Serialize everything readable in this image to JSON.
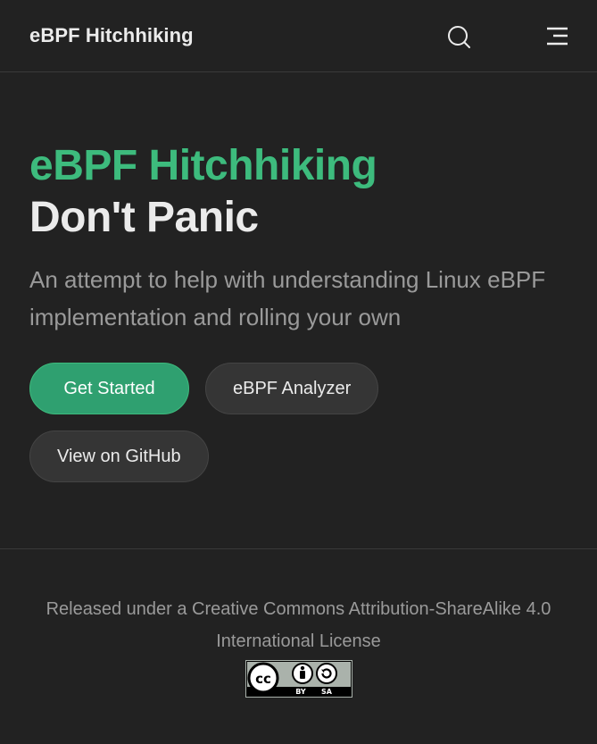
{
  "navbar": {
    "site_title": "eBPF Hitchhiking",
    "icons": {
      "search": "search-icon",
      "menu": "menu-icon"
    }
  },
  "hero": {
    "name": "eBPF Hitchhiking",
    "text": "Don't Panic",
    "tagline": "An attempt to help with understanding Linux eBPF implementation and rolling your own"
  },
  "actions": [
    {
      "label": "Get Started",
      "theme": "brand"
    },
    {
      "label": "eBPF Analyzer",
      "theme": "alt"
    },
    {
      "label": "View on GitHub",
      "theme": "alt"
    }
  ],
  "footer": {
    "message": "Released under a Creative Commons Attribution-ShareAlike 4.0 International License",
    "badge": {
      "icon": "cc-by-sa-badge-icon",
      "labels": [
        "BY",
        "SA"
      ]
    }
  },
  "colors": {
    "background": "#222222",
    "brand": "#3dbb7d",
    "button_brand_bg": "#2fa070",
    "button_alt_bg": "#353535",
    "text_primary": "#ebebeb",
    "text_muted": "#9a9a9a"
  }
}
